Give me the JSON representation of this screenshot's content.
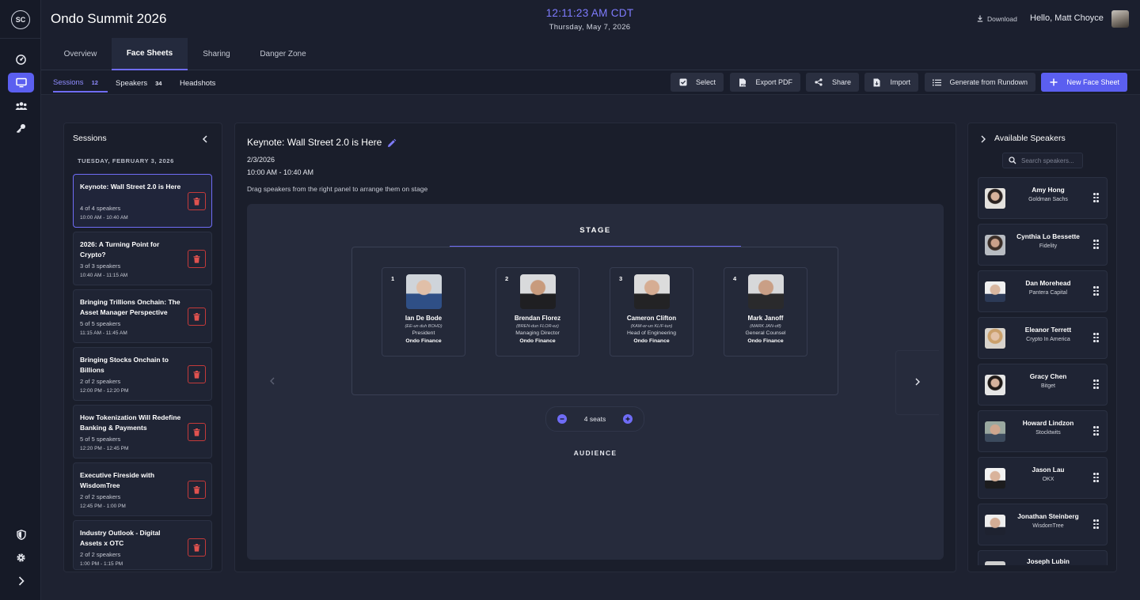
{
  "app": {
    "logo_text": "SC",
    "event_title": "Ondo Summit 2026",
    "clock": "12:11:23 AM CDT",
    "date": "Thursday, May 7, 2026",
    "download_label": "Download",
    "greeting": "Hello, Matt Choyce"
  },
  "main_tabs": [
    {
      "label": "Overview"
    },
    {
      "label": "Face Sheets"
    },
    {
      "label": "Sharing"
    },
    {
      "label": "Danger Zone"
    }
  ],
  "sub_tabs": [
    {
      "label": "Sessions",
      "count": "12"
    },
    {
      "label": "Speakers",
      "count": "34"
    },
    {
      "label": "Headshots"
    }
  ],
  "toolbar": {
    "select": "Select",
    "export_pdf": "Export PDF",
    "share": "Share",
    "import": "Import",
    "generate": "Generate from Rundown",
    "new_face_sheet": "New Face Sheet"
  },
  "sessions_panel": {
    "title": "Sessions",
    "day_label": "TUESDAY, FEBRUARY 3, 2026",
    "items": [
      {
        "title": "Keynote: Wall Street 2.0 is Here",
        "count": "4 of 4 speakers",
        "time": "10:00 AM - 10:40 AM"
      },
      {
        "title": "2026: A Turning Point for Crypto?",
        "count": "3 of 3 speakers",
        "time": "10:40 AM - 11:15 AM"
      },
      {
        "title": "Bringing Trillions Onchain: The Asset Manager Perspective",
        "count": "5 of 5 speakers",
        "time": "11:15 AM - 11:45 AM"
      },
      {
        "title": "Bringing Stocks Onchain to Billions",
        "count": "2 of 2 speakers",
        "time": "12:00 PM - 12:20 PM"
      },
      {
        "title": "How Tokenization Will Redefine Banking & Payments",
        "count": "5 of 5 speakers",
        "time": "12:20 PM - 12:45 PM"
      },
      {
        "title": "Executive Fireside with WisdomTree",
        "count": "2 of 2 speakers",
        "time": "12:45 PM - 1:00 PM"
      },
      {
        "title": "Industry Outlook - Digital Assets x OTC",
        "count": "2 of 2 speakers",
        "time": "1:00 PM - 1:15 PM"
      }
    ]
  },
  "session_detail": {
    "title": "Keynote: Wall Street 2.0 is Here",
    "date": "2/3/2026",
    "time": "10:00 AM - 10:40 AM",
    "hint": "Drag speakers from the right panel to arrange them on stage",
    "stage_label": "STAGE",
    "audience_label": "AUDIENCE",
    "seats_label": "4 seats",
    "seats": [
      {
        "num": "1",
        "name": "Ian De Bode",
        "pron": "(EE-un duh BOHD)",
        "role": "President",
        "org": "Ondo Finance"
      },
      {
        "num": "2",
        "name": "Brendan Florez",
        "pron": "(BREN-dun FLOR-ez)",
        "role": "Managing Director",
        "org": "Ondo Finance"
      },
      {
        "num": "3",
        "name": "Cameron Clifton",
        "pron": "(KAM-er-un KLIF-tun)",
        "role": "Head of Engineering",
        "org": "Ondo Finance"
      },
      {
        "num": "4",
        "name": "Mark Janoff",
        "pron": "(MARK JAN-off)",
        "role": "General Counsel",
        "org": "Ondo Finance"
      }
    ]
  },
  "speakers_panel": {
    "title": "Available Speakers",
    "search_placeholder": "Search speakers...",
    "items": [
      {
        "name": "Amy Hong",
        "org": "Goldman Sachs"
      },
      {
        "name": "Cynthia Lo Bessette",
        "org": "Fidelity"
      },
      {
        "name": "Dan Morehead",
        "org": "Pantera Capital"
      },
      {
        "name": "Eleanor Terrett",
        "org": "Crypto In America"
      },
      {
        "name": "Gracy Chen",
        "org": "Bitget"
      },
      {
        "name": "Howard Lindzon",
        "org": "Stocktwits"
      },
      {
        "name": "Jason Lau",
        "org": "OKX"
      },
      {
        "name": "Jonathan Steinberg",
        "org": "WisdomTree"
      },
      {
        "name": "Joseph Lubin",
        "org": ""
      }
    ]
  },
  "colors": {
    "accent": "#6f6cf6",
    "danger": "#e0524f",
    "background": "#1b1f2e"
  }
}
